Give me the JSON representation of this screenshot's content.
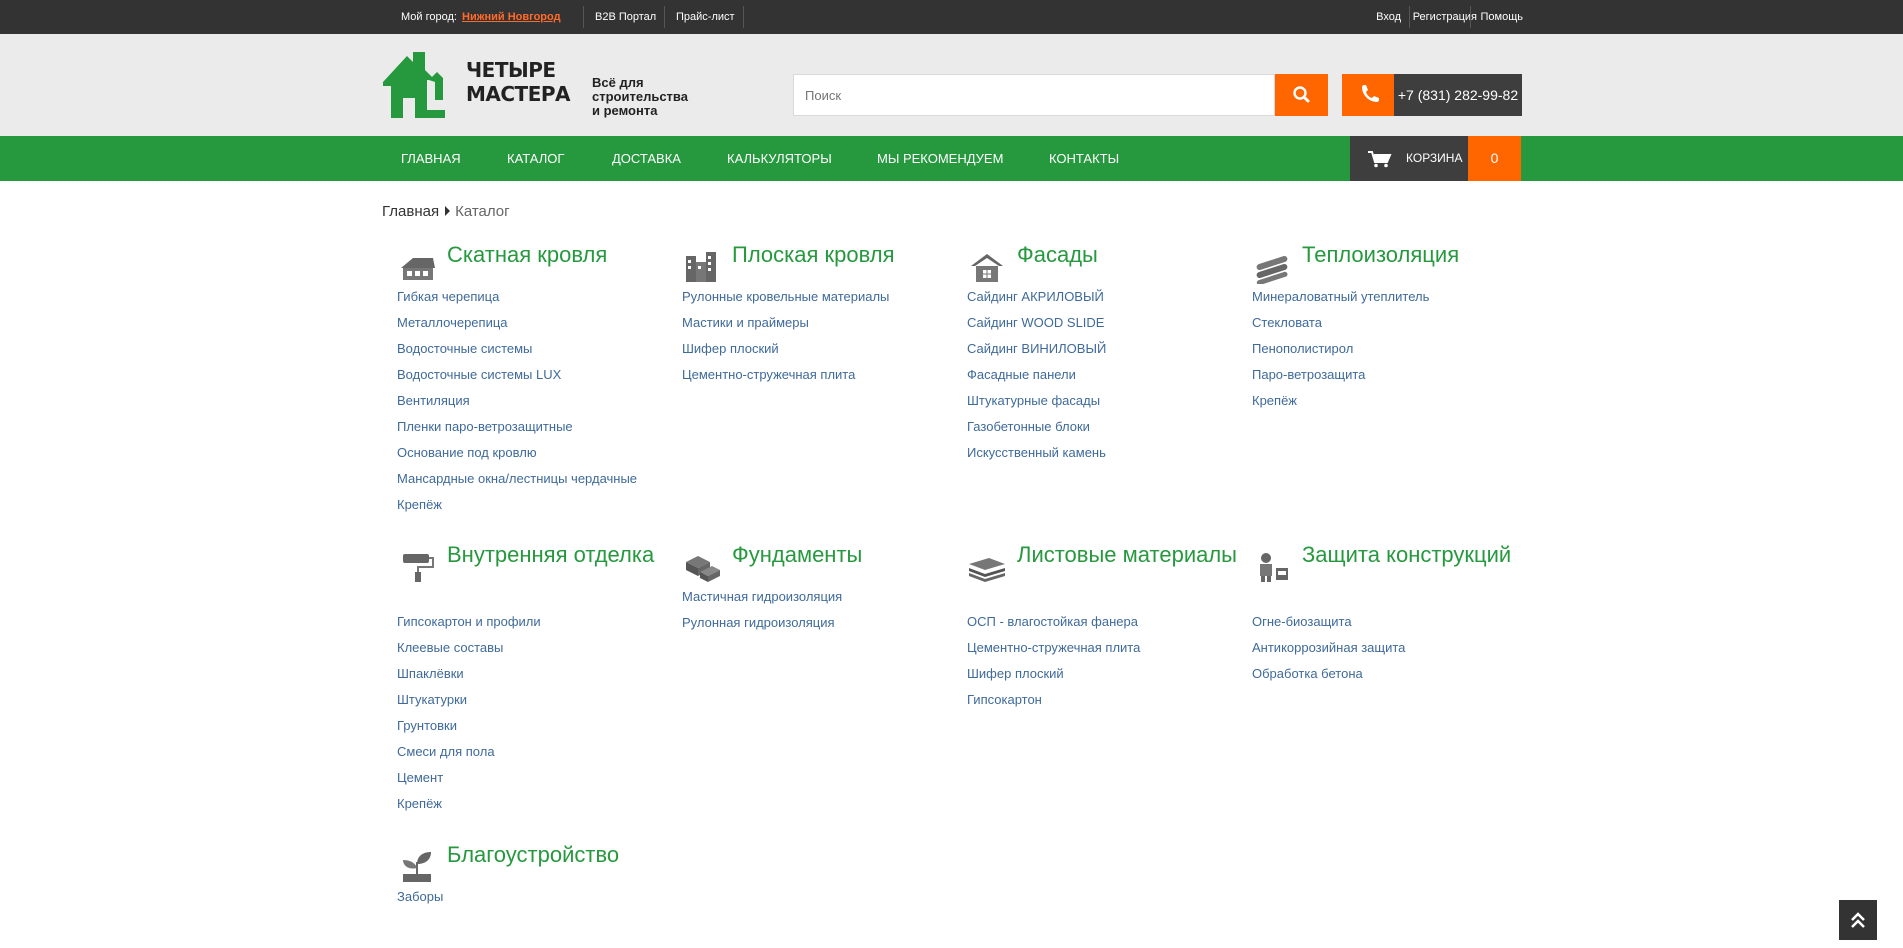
{
  "topbar": {
    "city_label": "Мой город:",
    "city": "Нижний Новгород",
    "b2b": "B2B Портал",
    "price_list": "Прайс-лист",
    "login": "Вход",
    "register": "Регистрация",
    "help": "Помощь"
  },
  "header": {
    "logo_line1": "ЧЕТЫРЕ",
    "logo_line2": "МАСТЕРА",
    "slogan_line1": "Всё для",
    "slogan_line2": "строительства",
    "slogan_line3": "и ремонта",
    "search_placeholder": "Поиск",
    "phone": "+7 (831) 282-99-82"
  },
  "nav": {
    "items": [
      "Главная",
      "Каталог",
      "Доставка",
      "Калькуляторы",
      "Мы рекомендуем",
      "Контакты"
    ],
    "cart_label": "Корзина",
    "cart_count": "0"
  },
  "breadcrumb": {
    "home": "Главная",
    "current": "Каталог"
  },
  "categories": [
    {
      "title": "Скатная кровля",
      "icon": "house-roof-icon",
      "items": [
        "Гибкая черепица",
        "Металлочерепица",
        "Водосточные системы",
        "Водосточные системы LUX",
        "Вентиляция",
        "Пленки паро-ветрозащитные",
        "Основание под кровлю",
        "Мансардные окна/лестницы чердачные",
        "Крепёж"
      ]
    },
    {
      "title": "Плоская кровля",
      "icon": "buildings-icon",
      "items": [
        "Рулонные кровельные материалы",
        "Мастики и праймеры",
        "Шифер плоский",
        "Цементно-стружечная плита"
      ]
    },
    {
      "title": "Фасады",
      "icon": "house-facade-icon",
      "items": [
        "Сайдинг АКРИЛОВЫЙ",
        "Сайдинг WOOD SLIDE",
        "Сайдинг ВИНИЛОВЫЙ",
        "Фасадные панели",
        "Штукатурные фасады",
        "Газобетонные блоки",
        "Искусственный камень"
      ]
    },
    {
      "title": "Теплоизоляция",
      "icon": "insulation-rolls-icon",
      "items": [
        "Минераловатный утеплитель",
        "Стекловата",
        "Пенополистирол",
        "Паро-ветрозащита",
        "Крепёж"
      ]
    },
    {
      "title": "Внутренняя отделка",
      "icon": "paint-roller-icon",
      "items": [
        "Гипсокартон и профили",
        "Клеевые составы",
        "Шпаклёвки",
        "Штукатурки",
        "Грунтовки",
        "Смеси для пола",
        "Цемент",
        "Крепёж"
      ]
    },
    {
      "title": "Фундаменты",
      "icon": "foundation-blocks-icon",
      "items": [
        "Мастичная гидроизоляция",
        "Рулонная гидроизоляция"
      ]
    },
    {
      "title": "Листовые материалы",
      "icon": "sheets-stack-icon",
      "items": [
        "ОСП - влагостойкая фанера",
        "Цементно-стружечная плита",
        "Шифер плоский",
        "Гипсокартон"
      ]
    },
    {
      "title": "Защита конструкций",
      "icon": "worker-bucket-icon",
      "items": [
        "Огне-биозащита",
        "Антикоррозийная защита",
        "Обработка бетона"
      ]
    },
    {
      "title": "Благоустройство",
      "icon": "sprout-icon",
      "items": [
        "Заборы"
      ]
    }
  ],
  "colors": {
    "green": "#26993f",
    "orange": "#ff6600",
    "dark": "#333333",
    "link": "#3f6a9a"
  }
}
